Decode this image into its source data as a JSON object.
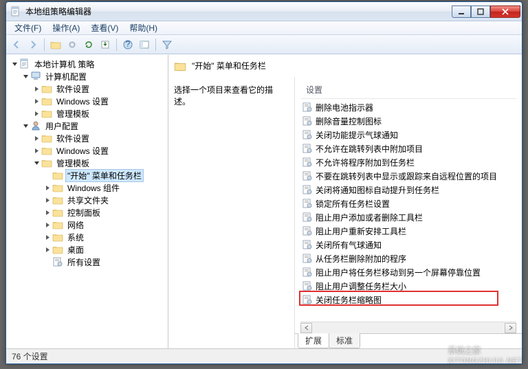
{
  "window": {
    "title": "本地组策略编辑器"
  },
  "menubar": [
    "文件(F)",
    "操作(A)",
    "查看(V)",
    "帮助(H)"
  ],
  "toolbar_icons": [
    "back",
    "forward",
    "sep",
    "up",
    "props",
    "refresh",
    "export",
    "sep",
    "help",
    "showhide",
    "sep",
    "filter"
  ],
  "tree": {
    "root": {
      "label": "本地计算机 策略"
    },
    "computer": {
      "label": "计算机配置",
      "children": [
        "软件设置",
        "Windows 设置",
        "管理模板"
      ]
    },
    "user": {
      "label": "用户配置",
      "soft": "软件设置",
      "win": "Windows 设置",
      "admin": {
        "label": "管理模板",
        "children": [
          "\"开始\" 菜单和任务栏",
          "Windows 组件",
          "共享文件夹",
          "控制面板",
          "网络",
          "系统",
          "桌面",
          "所有设置"
        ],
        "selected_index": 0
      }
    }
  },
  "right": {
    "header": "\"开始\" 菜单和任务栏",
    "desc_prompt": "选择一个项目来查看它的描述。",
    "column_header": "设置",
    "items": [
      "删除电池指示器",
      "删除音量控制图标",
      "关闭功能提示气球通知",
      "不允许在跳转列表中附加项目",
      "不允许将程序附加到任务栏",
      "不要在跳转列表中显示或跟踪来自远程位置的项目",
      "关闭将通知图标自动提升到任务栏",
      "锁定所有任务栏设置",
      "阻止用户添加或者删除工具栏",
      "阻止用户重新安排工具栏",
      "关闭所有气球通知",
      "从任务栏删除附加的程序",
      "阻止用户将任务栏移动到另一个屏幕停靠位置",
      "阻止用户调整任务栏大小",
      "关闭任务栏缩略图"
    ],
    "highlight_index": 14
  },
  "tabs": {
    "extended": "扩展",
    "standard": "标准"
  },
  "statusbar": "76 个设置",
  "watermark": {
    "main": "系统之家",
    "sub": "XITONGZHIJIA.NET"
  }
}
